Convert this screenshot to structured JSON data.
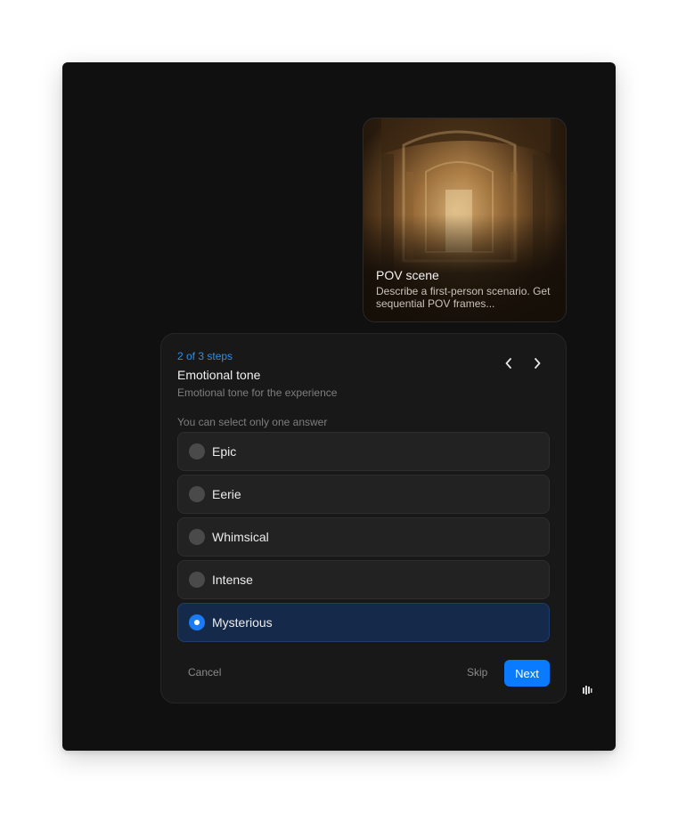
{
  "scene_card": {
    "title": "POV scene",
    "description": "Describe a first-person scenario. Get sequential POV frames..."
  },
  "wizard": {
    "step_counter": "2 of 3 steps",
    "title": "Emotional tone",
    "subtitle": "Emotional tone for the experience",
    "hint": "You can select only one answer",
    "options": [
      {
        "label": "Epic",
        "selected": false
      },
      {
        "label": "Eerie",
        "selected": false
      },
      {
        "label": "Whimsical",
        "selected": false
      },
      {
        "label": "Intense",
        "selected": false
      },
      {
        "label": "Mysterious",
        "selected": true
      }
    ],
    "cancel_label": "Cancel",
    "skip_label": "Skip",
    "next_label": "Next"
  },
  "icons": {
    "prev": "chevron-left-icon",
    "next": "chevron-right-icon",
    "brand": "brand-logo-icon"
  },
  "colors": {
    "accent": "#0a7bff",
    "step_counter": "#2e8fe6",
    "selected_bg": "#15294a",
    "window_bg": "#101010"
  }
}
